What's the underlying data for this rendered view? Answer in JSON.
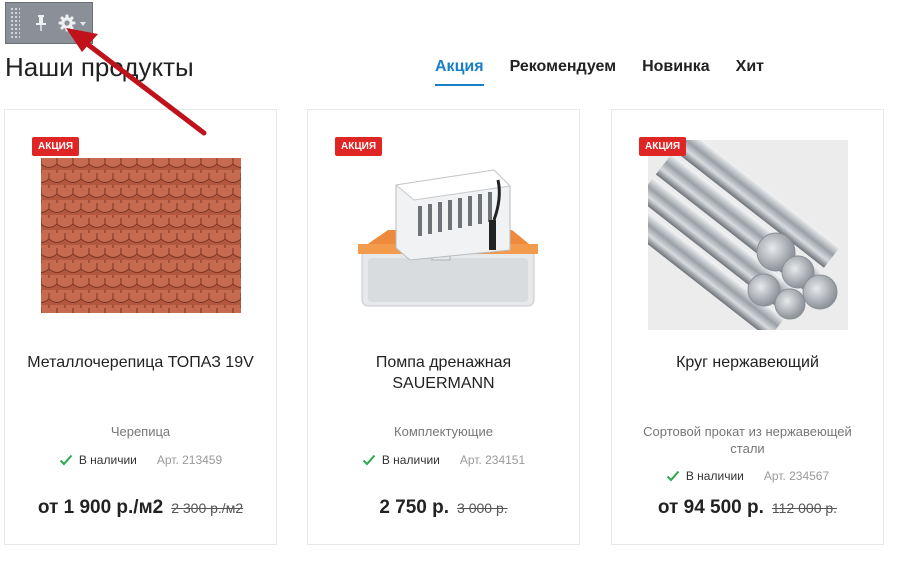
{
  "page": {
    "title": "Наши продукты"
  },
  "tabs": [
    {
      "label": "Акция",
      "active": true
    },
    {
      "label": "Рекомендуем",
      "active": false
    },
    {
      "label": "Новинка",
      "active": false
    },
    {
      "label": "Хит",
      "active": false
    }
  ],
  "toolbar": {
    "icons": [
      "drag-handle-icon",
      "pin-icon",
      "gear-icon",
      "caret-down-icon"
    ],
    "bg_color": "#8b8f98"
  },
  "annotation": {
    "arrow_color": "#c0121b"
  },
  "products": [
    {
      "badge": "АКЦИЯ",
      "name": "Металлочерепица ТОПАЗ 19V",
      "category": "Черепица",
      "stock": "В наличии",
      "article": "Арт. 213459",
      "price": "от 1 900 р./м2",
      "old_price": "2 300 р./м2",
      "image": "roof-tile-image"
    },
    {
      "badge": "АКЦИЯ",
      "name": "Помпа дренажная SAUERMANN",
      "category": "Комплектующие",
      "stock": "В наличии",
      "article": "Арт. 234151",
      "price": "2 750 р.",
      "old_price": "3 000 р.",
      "image": "drain-pump-image"
    },
    {
      "badge": "АКЦИЯ",
      "name": "Круг нержавеющий",
      "category": "Сортовой прокат из нержавеющей стали",
      "stock": "В наличии",
      "article": "Арт. 234567",
      "price": "от 94 500 р.",
      "old_price": "112 000 р.",
      "image": "steel-rods-image"
    }
  ],
  "colors": {
    "accent": "#1a80c5",
    "badge": "#e02525",
    "in_stock": "#2fa84f"
  }
}
